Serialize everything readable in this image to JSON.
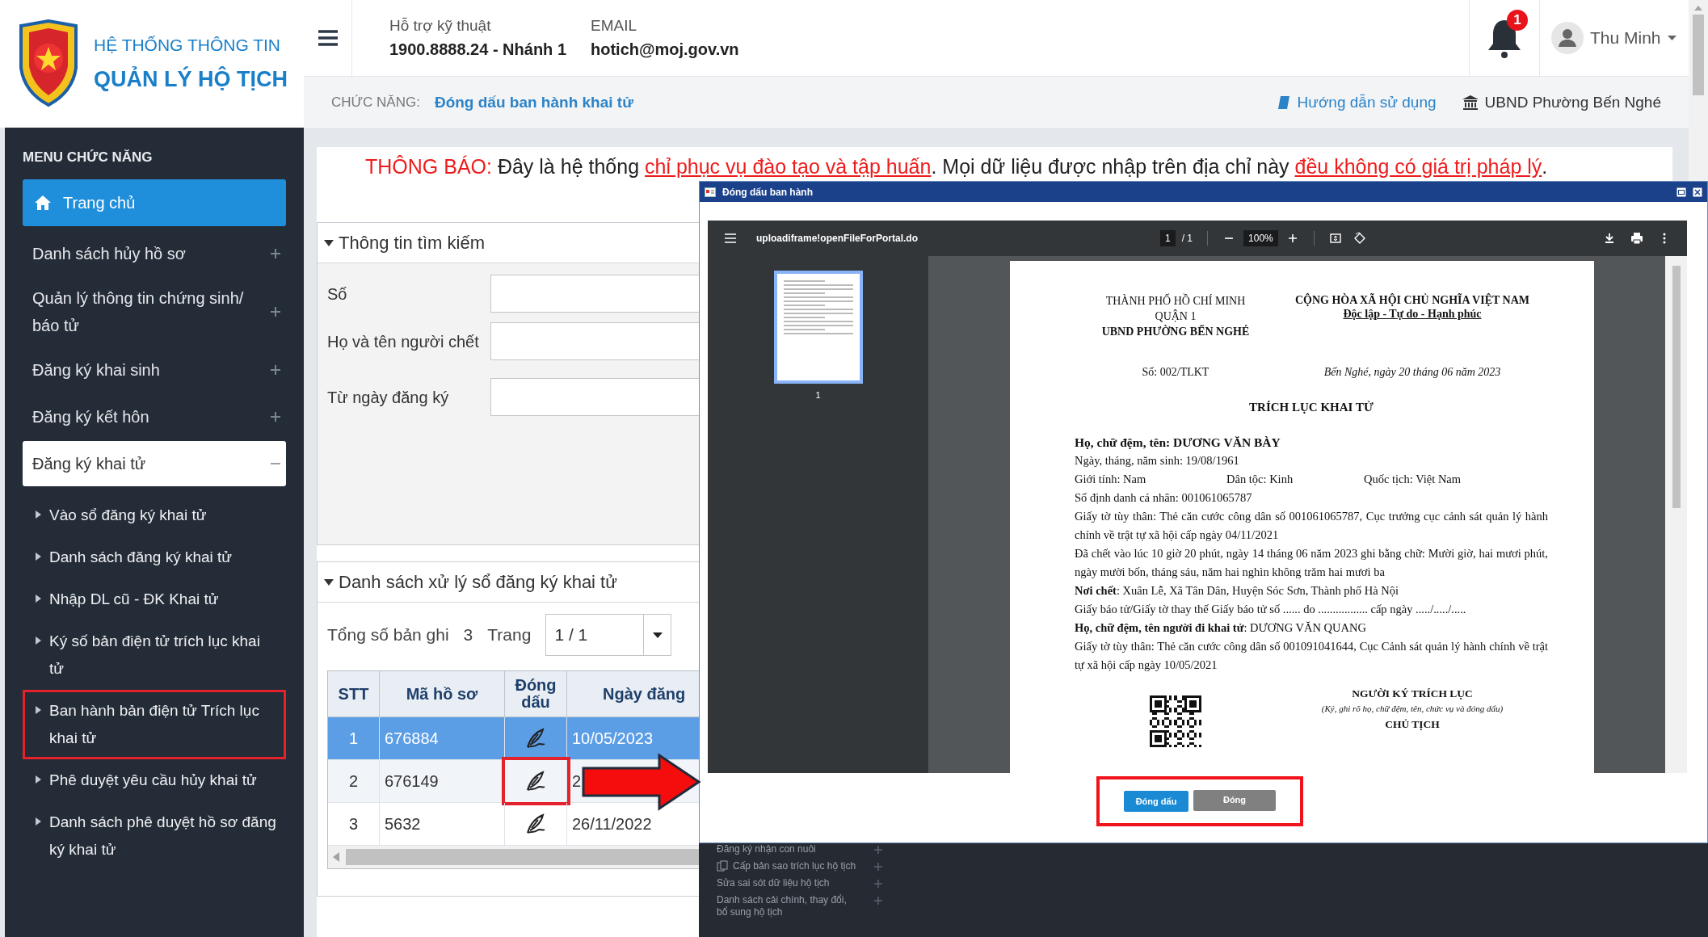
{
  "logo": {
    "line_1": "HỆ THỐNG THÔNG TIN",
    "line_2": "QUẢN LÝ HỘ TỊCH"
  },
  "header": {
    "support_label": "Hỗ trợ kỹ thuật",
    "support_phone": "1900.8888.24 - Nhánh 1",
    "email_label": "EMAIL",
    "email": "hotich@moj.gov.vn",
    "notification_count": "1",
    "user_name": "Thu Minh"
  },
  "breadcrumb": {
    "label": "CHỨC NĂNG:",
    "current": "Đóng dấu ban hành khai tử",
    "help_link": "Hướng dẫn sử dụng",
    "unit": "UBND Phường Bến Nghé"
  },
  "sidebar": {
    "title": "MENU CHỨC NĂNG",
    "items": [
      {
        "label": "Trang chủ",
        "kind": "home",
        "selected": true
      },
      {
        "label": "Danh sách hủy hồ sơ",
        "kind": "group",
        "selected": false,
        "expanded": false
      },
      {
        "label": "Quản lý thông tin chứng sinh/ báo tử",
        "kind": "group",
        "selected": false,
        "expanded": false
      },
      {
        "label": "Đăng ký khai sinh",
        "kind": "group",
        "selected": false,
        "expanded": false
      },
      {
        "label": "Đăng ký kết hôn",
        "kind": "group",
        "selected": false,
        "expanded": false
      },
      {
        "label": "Đăng ký khai tử",
        "kind": "group",
        "selected": false,
        "expanded": true,
        "children": [
          {
            "label": "Vào sổ đăng ký khai tử",
            "highlighted": false
          },
          {
            "label": "Danh sách đăng ký khai tử",
            "highlighted": false
          },
          {
            "label": "Nhập DL cũ - ĐK Khai tử",
            "highlighted": false
          },
          {
            "label": "Ký số bản điện tử trích lục khai tử",
            "highlighted": false
          },
          {
            "label": "Ban hành bản điện tử Trích lục khai tử",
            "highlighted": true
          },
          {
            "label": "Phê duyệt yêu cầu hủy khai tử",
            "highlighted": false
          },
          {
            "label": "Danh sách phê duyệt hồ sơ đăng ký khai tử",
            "highlighted": false
          }
        ]
      }
    ]
  },
  "notice": [
    {
      "text": "THÔNG BÁO:",
      "kind": "alert"
    },
    {
      "text": " Đây là hệ thống ",
      "kind": "plain"
    },
    {
      "text": "chỉ phục vụ đào tạo và tập huấn",
      "kind": "alert_underline"
    },
    {
      "text": ". Mọi dữ liệu được nhập trên địa chỉ này ",
      "kind": "plain"
    },
    {
      "text": "đều không có giá trị pháp lý",
      "kind": "alert_underline"
    },
    {
      "text": ".",
      "kind": "plain"
    }
  ],
  "search": {
    "title": "Thông tin tìm kiếm",
    "expanded": true,
    "fields": [
      {
        "label": "Số"
      },
      {
        "label": "Họ và tên người chết"
      },
      {
        "label": "Từ ngày đăng ký"
      }
    ]
  },
  "list": {
    "title": "Danh sách xử lý sổ đăng ký khai tử",
    "expanded": true,
    "total_label": "Tổng số bản ghi",
    "total": "3",
    "page_label": "Trang",
    "page_value": "1 / 1",
    "columns": [
      "STT",
      "Mã hồ sơ",
      "Đóng dấu",
      "Ngày đăng"
    ],
    "rows": [
      {
        "stt": "1",
        "code": "676884",
        "date": "10/05/2023",
        "selected": true,
        "highlighted": false
      },
      {
        "stt": "2",
        "code": "676149",
        "date": "2",
        "selected": false,
        "highlighted": true
      },
      {
        "stt": "3",
        "code": "5632",
        "date": "26/11/2022",
        "selected": false,
        "highlighted": false
      }
    ]
  },
  "modal": {
    "title": "Đóng dấu ban hành",
    "viewer": {
      "file_name": "uploadiframe!openFileForPortal.do",
      "page_current": "1",
      "page_total": "/ 1",
      "zoom": "100%",
      "thumbnail_label": "1"
    },
    "document": {
      "left_header": [
        {
          "text": "THÀNH PHỐ HỒ CHÍ MINH",
          "bold": false
        },
        {
          "text": "QUẬN 1",
          "bold": false
        },
        {
          "text": "UBND PHƯỜNG BẾN NGHÉ",
          "bold": true
        }
      ],
      "right_header": [
        {
          "text": "CỘNG HÒA XÃ HỘI CHỦ NGHĨA VIỆT NAM",
          "underline": false
        },
        {
          "text": "Độc lập - Tự do - Hạnh phúc",
          "underline": true
        }
      ],
      "number": "Số: 002/TLKT",
      "place_date": "Bến Nghé, ngày 20 tháng 06 năm 2023",
      "title": "TRÍCH LỤC KHAI TỬ",
      "lines": [
        {
          "kind": "heading",
          "text": "Họ, chữ đệm, tên: DƯƠNG VĂN BÀY"
        },
        {
          "kind": "text",
          "text": "Ngày, tháng, năm sinh: 19/08/1961"
        },
        {
          "kind": "columns",
          "cells": [
            "Giới tính: Nam",
            "Dân tộc: Kinh",
            "Quốc tịch: Việt Nam"
          ]
        },
        {
          "kind": "text",
          "text": "Số định danh cá nhân: 001061065787"
        },
        {
          "kind": "text",
          "text": "Giấy tờ tùy thân: Thẻ căn cước công dân số 001061065787, Cục trưởng cục cảnh sát quản lý hành chính về trật tự xã hội cấp ngày 04/11/2021"
        },
        {
          "kind": "text",
          "text": "Đã chết vào lúc 10 giờ 20 phút, ngày 14 tháng 06 năm 2023 ghi bằng chữ: Mười giờ, hai mươi phút, ngày mười bốn, tháng sáu, năm hai nghìn không trăm hai mươi ba"
        },
        {
          "kind": "text",
          "text": "**Nơi chết**: Xuân Lễ, Xã Tân Dân, Huyện Sóc Sơn, Thành phố Hà Nội"
        },
        {
          "kind": "text",
          "text": "Giấy báo tử/Giấy tờ thay thế Giấy báo tử số ...... do ................. cấp ngày ...../...../....."
        },
        {
          "kind": "text",
          "text": "**Họ, chữ đệm, tên người đi khai tử**: DƯƠNG VĂN QUANG"
        },
        {
          "kind": "text",
          "text": "Giấy tờ tùy thân: Thẻ căn cước công dân số 001091041644, Cục Cảnh sát quản lý hành chính về trật tự xã hội cấp ngày 10/05/2021"
        }
      ],
      "signer_title": "NGƯỜI KÝ TRÍCH LỤC",
      "signer_note": "(Ký, ghi rõ họ, chữ đệm, tên, chức vụ và đóng dấu)",
      "signer_position": "CHỦ TỊCH"
    },
    "buttons": [
      {
        "label": "Đóng dấu",
        "kind": "primary"
      },
      {
        "label": "Đóng",
        "kind": "secondary"
      }
    ],
    "buttons_highlighted": true
  },
  "background_menu": [
    {
      "label": "Đăng ký nhận con nuôi",
      "kind": "plain"
    },
    {
      "label": "Cấp bản sao trích lục hộ tịch",
      "kind": "with_icon"
    },
    {
      "label": "Sửa sai sót dữ liệu hộ tịch",
      "kind": "plain"
    },
    {
      "label": "Danh sách cải chính, thay đổi, bổ sung hộ tịch",
      "kind": "plain"
    }
  ]
}
